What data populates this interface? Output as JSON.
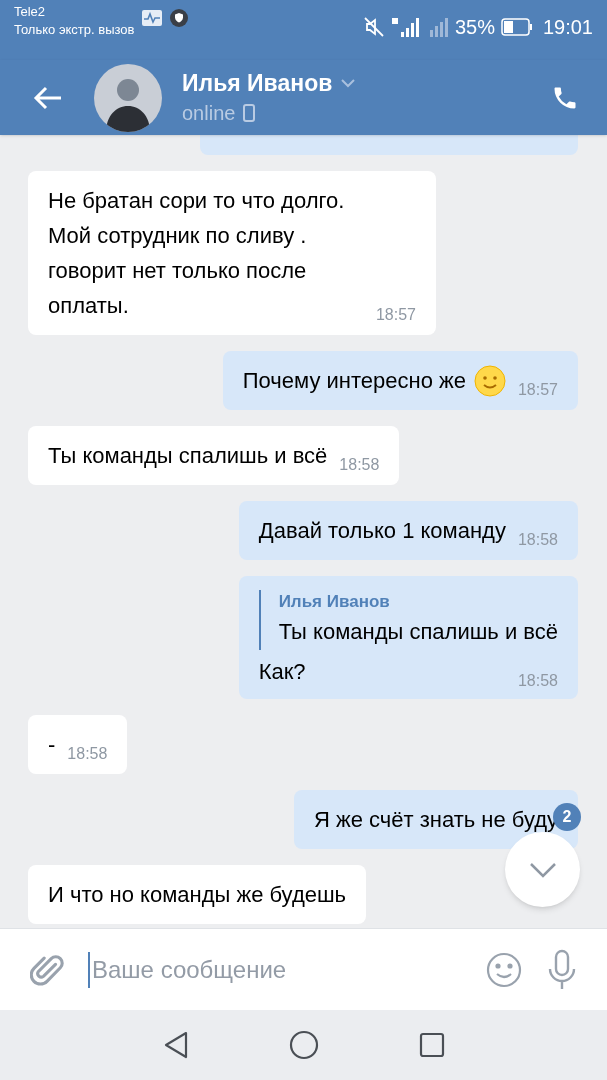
{
  "status_bar": {
    "carrier": "Tele2",
    "emergency": "Только экстр. вызов",
    "battery": "35%",
    "time": "19:01"
  },
  "header": {
    "name": "Илья Иванов",
    "status": "online"
  },
  "messages": [
    {
      "kind": "stub"
    },
    {
      "kind": "incoming",
      "text": "Не братан сори то что долго. Мой сотрудник по сливу . говорит нет только после оплаты.",
      "time": "18:57"
    },
    {
      "kind": "outgoing",
      "text": "Почему интересно же",
      "emoji": true,
      "time": "18:57"
    },
    {
      "kind": "incoming",
      "text": "Ты команды спалишь и всё",
      "time": "18:58"
    },
    {
      "kind": "outgoing",
      "text": "Давай только 1 команду",
      "time": "18:58"
    },
    {
      "kind": "outgoing",
      "quote": {
        "author": "Илья Иванов",
        "text": "Ты команды спалишь и всё"
      },
      "text": "Как?",
      "time": "18:58"
    },
    {
      "kind": "incoming",
      "text": "-",
      "time": "18:58"
    },
    {
      "kind": "outgoing",
      "text": "Я же счёт знать не буду"
    },
    {
      "kind": "incoming",
      "text": "И что но команды же будешь"
    }
  ],
  "scroll_button": {
    "badge": "2"
  },
  "composer": {
    "placeholder": "Ваше сообщение"
  }
}
